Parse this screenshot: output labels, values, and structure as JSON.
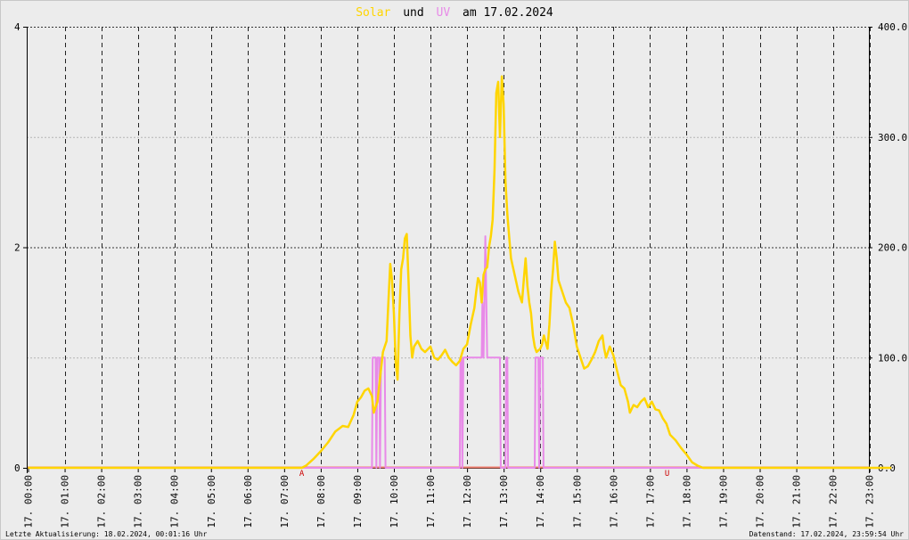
{
  "title": {
    "part1": "Solar",
    "part2": "und",
    "part3": "UV",
    "part4": "am 17.02.2024"
  },
  "footer": {
    "left": "Letzte Aktualisierung: 18.02.2024, 00:01:16 Uhr",
    "right": "Datenstand: 17.02.2024, 23:59:54 Uhr"
  },
  "colors": {
    "solar": "#ffd500",
    "uv": "#e88ae8",
    "baseline": "#f08070",
    "marker": "#cc0000",
    "background": "#ececec"
  },
  "markers": {
    "sunrise": "A",
    "sunset": "U"
  },
  "chart_data": {
    "type": "line",
    "x_unit": "hour of day",
    "xlim": [
      0,
      23.6
    ],
    "x_ticks": [
      "17. 00:00",
      "17. 01:00",
      "17. 02:00",
      "17. 03:00",
      "17. 04:00",
      "17. 05:00",
      "17. 06:00",
      "17. 07:00",
      "17. 08:00",
      "17. 09:00",
      "17. 10:00",
      "17. 11:00",
      "17. 12:00",
      "17. 13:00",
      "17. 14:00",
      "17. 15:00",
      "17. 16:00",
      "17. 17:00",
      "17. 18:00",
      "17. 19:00",
      "17. 20:00",
      "17. 21:00",
      "17. 22:00",
      "17. 23:00"
    ],
    "y_left": {
      "lim": [
        0,
        4
      ],
      "ticks": [
        "0",
        "2",
        "4"
      ],
      "tick_values": [
        0,
        2,
        4
      ]
    },
    "y_right": {
      "lim": [
        0,
        400
      ],
      "ticks": [
        "0.0",
        "100.0",
        "200.0",
        "300.0",
        "400.0"
      ],
      "tick_values": [
        0,
        100,
        200,
        300,
        400
      ]
    },
    "sunrise_hour": 7.48,
    "sunset_hour": 17.47,
    "grid": true,
    "series": [
      {
        "name": "UV",
        "axis": "left",
        "points": [
          [
            0,
            0
          ],
          [
            9.4,
            0
          ],
          [
            9.42,
            1
          ],
          [
            9.5,
            1
          ],
          [
            9.52,
            0
          ],
          [
            9.55,
            1
          ],
          [
            9.6,
            1
          ],
          [
            9.62,
            0
          ],
          [
            9.65,
            1
          ],
          [
            9.75,
            1
          ],
          [
            9.77,
            0
          ],
          [
            11.8,
            0
          ],
          [
            11.82,
            1
          ],
          [
            11.85,
            1
          ],
          [
            11.87,
            0
          ],
          [
            11.9,
            1
          ],
          [
            12.4,
            1
          ],
          [
            12.42,
            1.5
          ],
          [
            12.45,
            1
          ],
          [
            12.5,
            2.1
          ],
          [
            12.55,
            1
          ],
          [
            12.9,
            1
          ],
          [
            12.92,
            0
          ],
          [
            13.05,
            0
          ],
          [
            13.07,
            1
          ],
          [
            13.1,
            1
          ],
          [
            13.12,
            0
          ],
          [
            13.85,
            0
          ],
          [
            13.87,
            1
          ],
          [
            13.95,
            1
          ],
          [
            13.97,
            0
          ],
          [
            14.0,
            1
          ],
          [
            14.07,
            1
          ],
          [
            14.09,
            0
          ],
          [
            23.6,
            0
          ]
        ]
      },
      {
        "name": "Solar",
        "axis": "right",
        "points": [
          [
            0,
            0
          ],
          [
            7.48,
            0
          ],
          [
            7.6,
            2
          ],
          [
            7.8,
            8
          ],
          [
            8.0,
            15
          ],
          [
            8.2,
            23
          ],
          [
            8.4,
            33
          ],
          [
            8.6,
            38
          ],
          [
            8.75,
            37
          ],
          [
            8.9,
            48
          ],
          [
            9.0,
            60
          ],
          [
            9.1,
            64
          ],
          [
            9.2,
            70
          ],
          [
            9.3,
            72
          ],
          [
            9.4,
            65
          ],
          [
            9.45,
            50
          ],
          [
            9.55,
            60
          ],
          [
            9.6,
            75
          ],
          [
            9.65,
            90
          ],
          [
            9.7,
            105
          ],
          [
            9.75,
            110
          ],
          [
            9.8,
            115
          ],
          [
            9.85,
            150
          ],
          [
            9.9,
            185
          ],
          [
            9.95,
            170
          ],
          [
            10.0,
            140
          ],
          [
            10.05,
            95
          ],
          [
            10.1,
            80
          ],
          [
            10.15,
            140
          ],
          [
            10.2,
            180
          ],
          [
            10.25,
            190
          ],
          [
            10.3,
            208
          ],
          [
            10.35,
            212
          ],
          [
            10.4,
            170
          ],
          [
            10.45,
            120
          ],
          [
            10.5,
            100
          ],
          [
            10.55,
            110
          ],
          [
            10.65,
            115
          ],
          [
            10.75,
            108
          ],
          [
            10.85,
            105
          ],
          [
            11.0,
            110
          ],
          [
            11.1,
            100
          ],
          [
            11.2,
            98
          ],
          [
            11.3,
            102
          ],
          [
            11.4,
            107
          ],
          [
            11.5,
            100
          ],
          [
            11.6,
            96
          ],
          [
            11.7,
            93
          ],
          [
            11.8,
            97
          ],
          [
            11.9,
            108
          ],
          [
            12.0,
            112
          ],
          [
            12.1,
            130
          ],
          [
            12.2,
            145
          ],
          [
            12.25,
            160
          ],
          [
            12.3,
            172
          ],
          [
            12.35,
            168
          ],
          [
            12.4,
            150
          ],
          [
            12.45,
            175
          ],
          [
            12.5,
            180
          ],
          [
            12.55,
            182
          ],
          [
            12.6,
            200
          ],
          [
            12.65,
            210
          ],
          [
            12.7,
            225
          ],
          [
            12.75,
            270
          ],
          [
            12.8,
            340
          ],
          [
            12.85,
            350
          ],
          [
            12.9,
            300
          ],
          [
            12.95,
            355
          ],
          [
            13.0,
            330
          ],
          [
            13.05,
            260
          ],
          [
            13.1,
            230
          ],
          [
            13.15,
            210
          ],
          [
            13.2,
            190
          ],
          [
            13.3,
            175
          ],
          [
            13.4,
            160
          ],
          [
            13.5,
            150
          ],
          [
            13.55,
            170
          ],
          [
            13.6,
            190
          ],
          [
            13.65,
            165
          ],
          [
            13.7,
            150
          ],
          [
            13.75,
            140
          ],
          [
            13.8,
            120
          ],
          [
            13.85,
            110
          ],
          [
            13.9,
            105
          ],
          [
            14.0,
            108
          ],
          [
            14.05,
            112
          ],
          [
            14.1,
            120
          ],
          [
            14.2,
            108
          ],
          [
            14.25,
            130
          ],
          [
            14.3,
            160
          ],
          [
            14.35,
            180
          ],
          [
            14.4,
            205
          ],
          [
            14.45,
            190
          ],
          [
            14.5,
            170
          ],
          [
            14.6,
            160
          ],
          [
            14.7,
            150
          ],
          [
            14.8,
            145
          ],
          [
            14.9,
            130
          ],
          [
            15.0,
            110
          ],
          [
            15.1,
            100
          ],
          [
            15.2,
            90
          ],
          [
            15.3,
            92
          ],
          [
            15.4,
            98
          ],
          [
            15.5,
            105
          ],
          [
            15.6,
            115
          ],
          [
            15.7,
            120
          ],
          [
            15.75,
            108
          ],
          [
            15.8,
            100
          ],
          [
            15.9,
            110
          ],
          [
            16.0,
            102
          ],
          [
            16.1,
            88
          ],
          [
            16.2,
            75
          ],
          [
            16.3,
            72
          ],
          [
            16.4,
            60
          ],
          [
            16.45,
            50
          ],
          [
            16.55,
            57
          ],
          [
            16.65,
            55
          ],
          [
            16.75,
            60
          ],
          [
            16.85,
            63
          ],
          [
            16.95,
            55
          ],
          [
            17.05,
            60
          ],
          [
            17.15,
            53
          ],
          [
            17.25,
            52
          ],
          [
            17.35,
            45
          ],
          [
            17.45,
            40
          ],
          [
            17.55,
            30
          ],
          [
            17.7,
            25
          ],
          [
            17.85,
            18
          ],
          [
            18.0,
            12
          ],
          [
            18.15,
            5
          ],
          [
            18.3,
            2
          ],
          [
            18.45,
            0
          ],
          [
            23.6,
            0
          ]
        ]
      }
    ]
  }
}
